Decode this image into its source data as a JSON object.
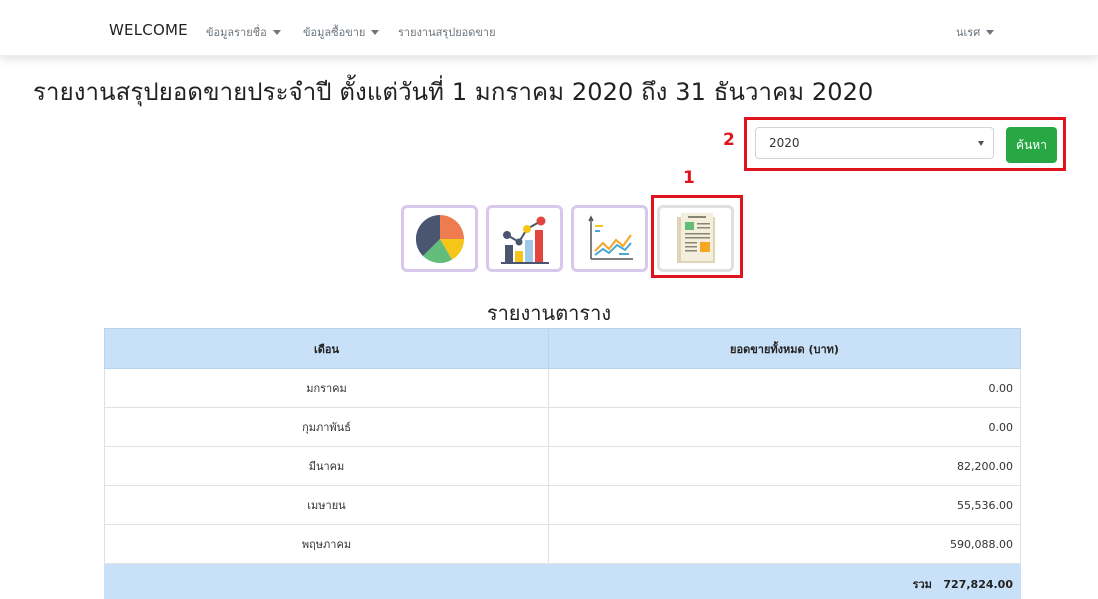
{
  "nav": {
    "brand": "WELCOME",
    "items": [
      {
        "label": "ข้อมูลรายชื่อ",
        "has_caret": true
      },
      {
        "label": "ข้อมูลซื้อขาย",
        "has_caret": true
      },
      {
        "label": "รายงานสรุปยอดขาย",
        "has_caret": false
      }
    ],
    "user": "นเรศ"
  },
  "page": {
    "title": "รายงานสรุปยอดขายประจำปี ตั้งแต่วันที่ 1 มกราคม 2020 ถึง 31 ธันวาคม 2020"
  },
  "annotations": {
    "marker1": "1",
    "marker2": "2",
    "color": "#e0141d"
  },
  "search": {
    "year_value": "2020",
    "button_label": "ค้นหา",
    "button_color": "#28a745"
  },
  "view_icons": [
    "pie-chart-icon",
    "bar-chart-icon",
    "line-chart-icon",
    "table-report-icon"
  ],
  "table": {
    "title": "รายงานตาราง",
    "headers": [
      "เดือน",
      "ยอดขายทั้งหมด (บาท)"
    ],
    "rows": [
      {
        "month": "มกราคม",
        "amount": "0.00"
      },
      {
        "month": "กุมภาพันธ์",
        "amount": "0.00"
      },
      {
        "month": "มีนาคม",
        "amount": "82,200.00"
      },
      {
        "month": "เมษายน",
        "amount": "55,536.00"
      },
      {
        "month": "พฤษภาคม",
        "amount": "590,088.00"
      }
    ],
    "total_label": "รวม",
    "total_amount": "727,824.00",
    "header_color": "#c9e1f8"
  }
}
